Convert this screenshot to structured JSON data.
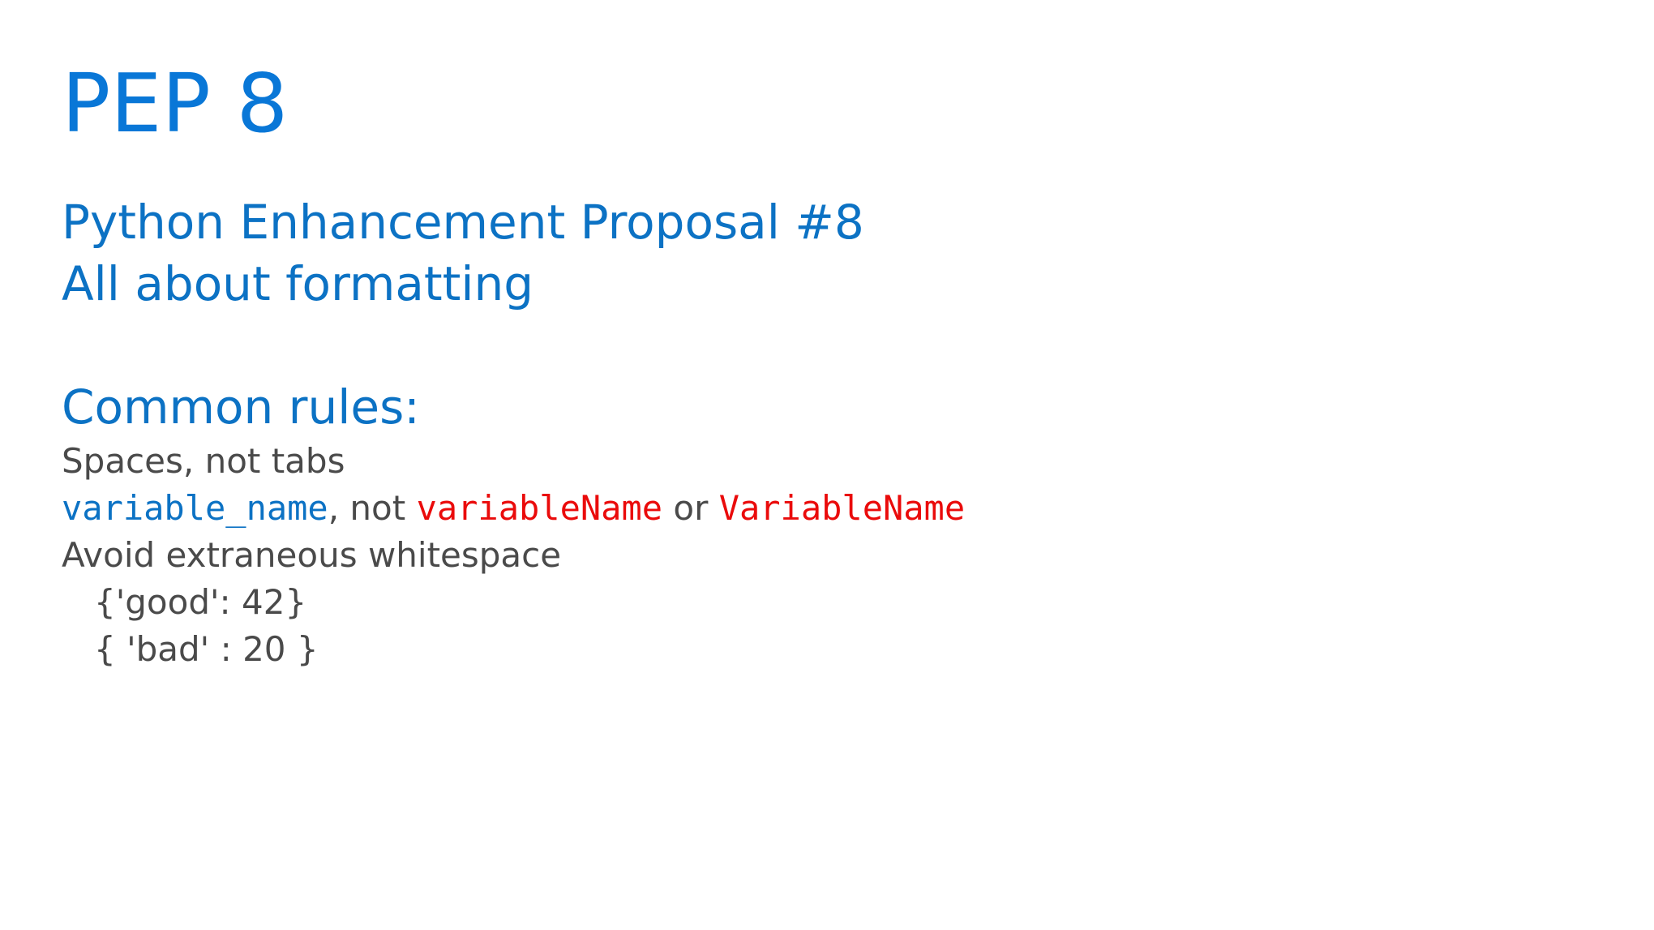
{
  "slide": {
    "title": "PEP 8",
    "subtitle_lines": [
      "Python Enhancement Proposal #8",
      "All about formatting"
    ],
    "rules_heading": "Common rules:",
    "rules": {
      "spaces": "Spaces, not tabs",
      "naming": {
        "good": "variable_name",
        "sep1": ", not ",
        "bad1": "variableName",
        "sep2": " or ",
        "bad2": "VariableName"
      },
      "whitespace": "Avoid extraneous whitespace",
      "whitespace_good_example": "{'good': 42}",
      "whitespace_bad_example": "{ 'bad' : 20 }"
    }
  },
  "colors": {
    "heading": "#0977d7",
    "good_code": "#0c72c4",
    "bad_code": "#ea0b0b",
    "body_text": "#4a4a4a"
  }
}
